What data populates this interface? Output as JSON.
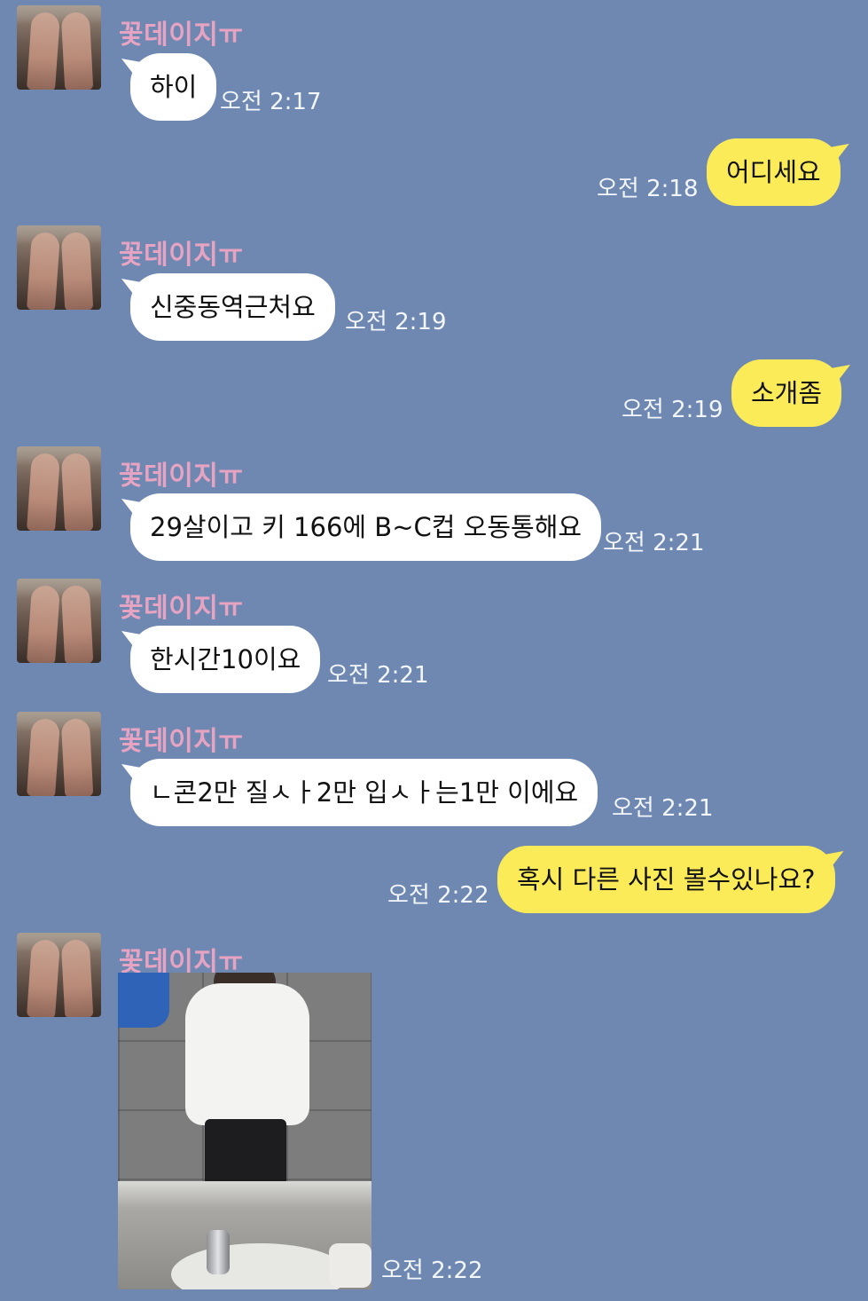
{
  "contact": {
    "name": "꽃데이지ㅠ"
  },
  "messages": [
    {
      "dir": "in",
      "text": "하이",
      "time": "오전 2:17"
    },
    {
      "dir": "out",
      "text": "어디세요",
      "time": "오전 2:18"
    },
    {
      "dir": "in",
      "text": "신중동역근처요",
      "time": "오전 2:19"
    },
    {
      "dir": "out",
      "text": "소개좀",
      "time": "오전 2:19"
    },
    {
      "dir": "in",
      "text": "29살이고 키 166에 B~C컵 오동통해요",
      "time": "오전 2:21"
    },
    {
      "dir": "in",
      "text": "한시간10이요",
      "time": "오전 2:21"
    },
    {
      "dir": "in",
      "text": "ㄴ콘2만 질ㅅㅏ2만 입ㅅㅏ는1만 이에요",
      "time": "오전 2:21"
    },
    {
      "dir": "out",
      "text": "혹시 다른 사진 볼수있나요?",
      "time": "오전 2:22"
    },
    {
      "dir": "in",
      "type": "photo",
      "time": "오전 2:22"
    }
  ],
  "colors": {
    "background": "#6f88b1",
    "incoming_bubble": "#ffffff",
    "outgoing_bubble": "#fbeb58",
    "sender_name": "#e7a3c2",
    "timestamp": "#f3f6fb"
  }
}
